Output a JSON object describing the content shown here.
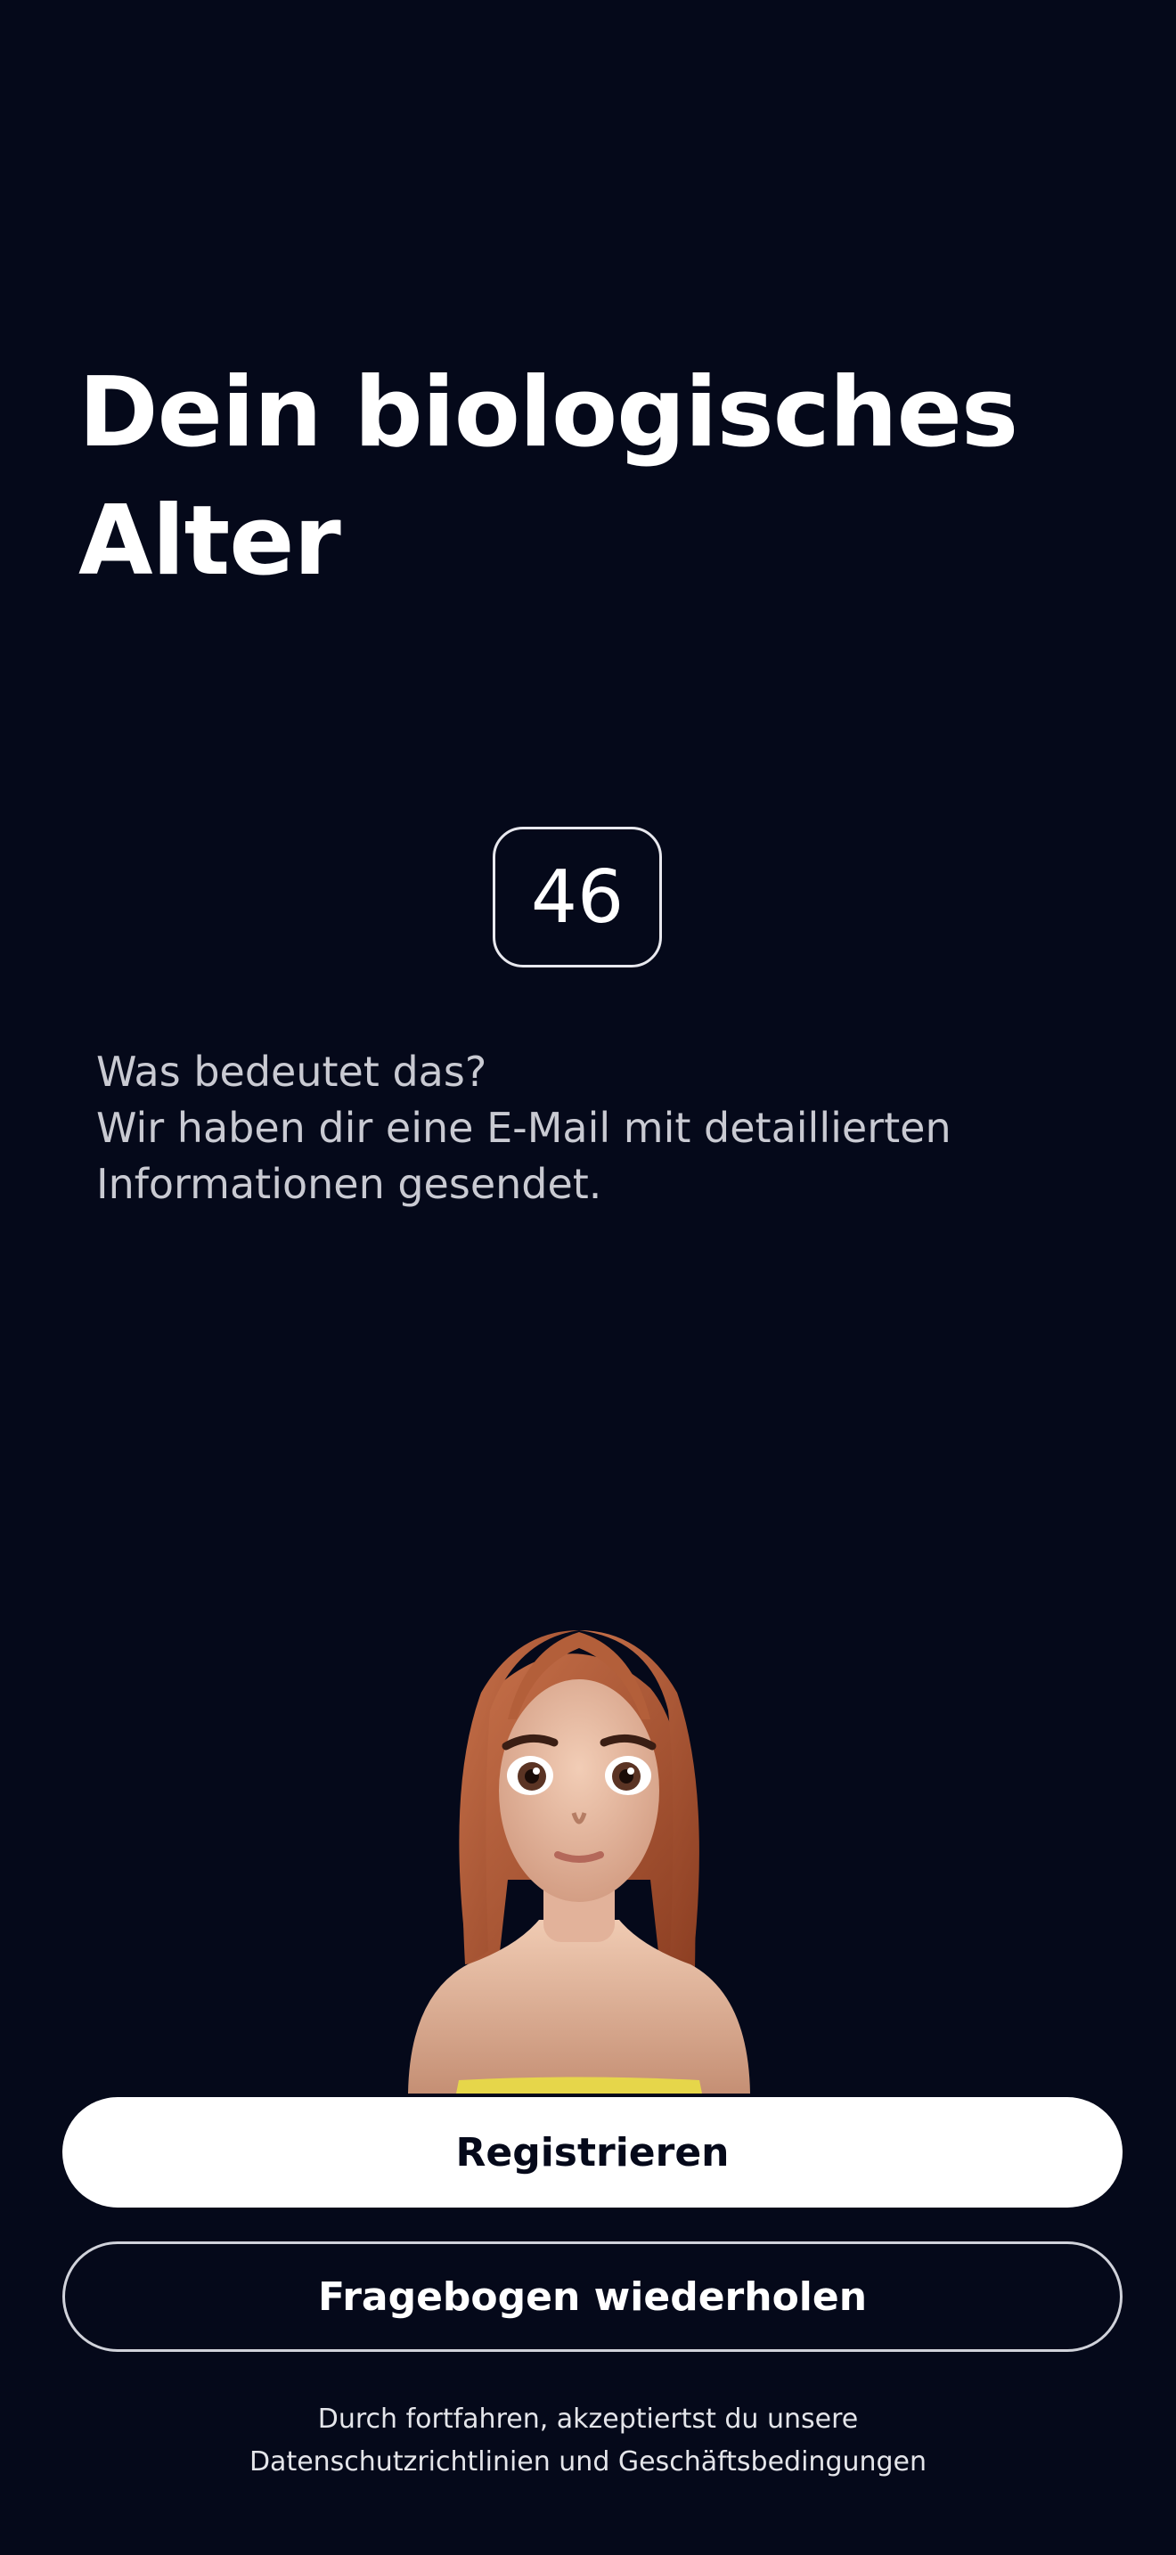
{
  "result": {
    "title_line1": "Dein biologisches",
    "title_line2": "Alter",
    "age_value": "46"
  },
  "info": {
    "line1": "Was bedeutet das?",
    "line2": "Wir haben dir eine E-Mail mit detaillierten",
    "line3": "Informationen gesendet."
  },
  "actions": {
    "register_label": "Registrieren",
    "repeat_label": "Fragebogen wiederholen"
  },
  "legal": {
    "line1": "Durch fortfahren, akzeptiertst du unsere",
    "line2": "Datenschutzrichtlinien und Geschäftsbedingungen"
  },
  "colors": {
    "background": "#05091a",
    "primary_button": "#ffffff",
    "text_muted": "#c9cad2"
  }
}
